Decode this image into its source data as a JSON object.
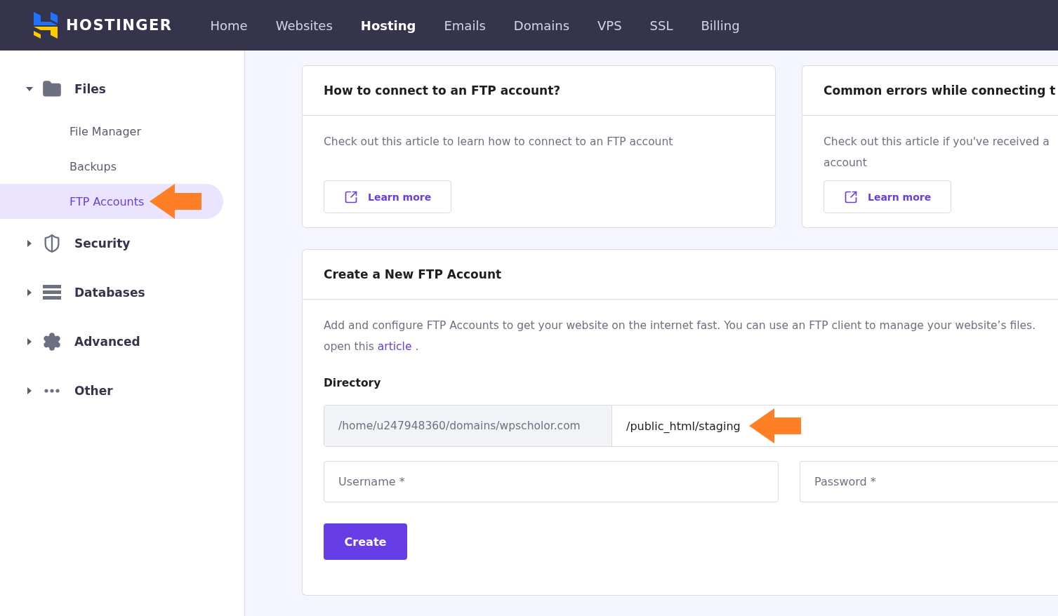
{
  "header": {
    "brand": "HOSTINGER",
    "nav": [
      {
        "label": "Home",
        "selected": false
      },
      {
        "label": "Websites",
        "selected": false
      },
      {
        "label": "Hosting",
        "selected": true
      },
      {
        "label": "Emails",
        "selected": false
      },
      {
        "label": "Domains",
        "selected": false
      },
      {
        "label": "VPS",
        "selected": false
      },
      {
        "label": "SSL",
        "selected": false
      },
      {
        "label": "Billing",
        "selected": false
      }
    ]
  },
  "sidebar": {
    "items": [
      {
        "label": "Files",
        "kind": "folder",
        "expanded": true,
        "children": [
          {
            "label": "File Manager",
            "selected": false
          },
          {
            "label": "Backups",
            "selected": false
          },
          {
            "label": "FTP Accounts",
            "selected": true
          }
        ]
      },
      {
        "label": "Security",
        "kind": "shield",
        "expanded": false
      },
      {
        "label": "Databases",
        "kind": "database",
        "expanded": false
      },
      {
        "label": "Advanced",
        "kind": "gear",
        "expanded": false
      },
      {
        "label": "Other",
        "kind": "dots",
        "expanded": false
      }
    ]
  },
  "articles": [
    {
      "title": "How to connect to an FTP account?",
      "text": "Check out this article to learn how to connect to an FTP account",
      "button": "Learn more"
    },
    {
      "title": "Common errors while connecting t",
      "text": "Check out this article if you've received a",
      "text_2": "account",
      "button": "Learn more"
    }
  ],
  "create_form": {
    "title": "Create a New FTP Account",
    "description_lines": [
      "Add and configure FTP Accounts to get your website on the internet fast. You can use an FTP client to manage your website’s files.",
      "open this"
    ],
    "link": "article",
    "after": ".",
    "directory": {
      "label": "Directory",
      "prefix": "/home/u247948360/domains/wpscholor.com",
      "value": "/public_html/staging"
    },
    "fields": [
      {
        "placeholder": "Username *"
      },
      {
        "placeholder": "Password *"
      }
    ],
    "button": "Create"
  }
}
